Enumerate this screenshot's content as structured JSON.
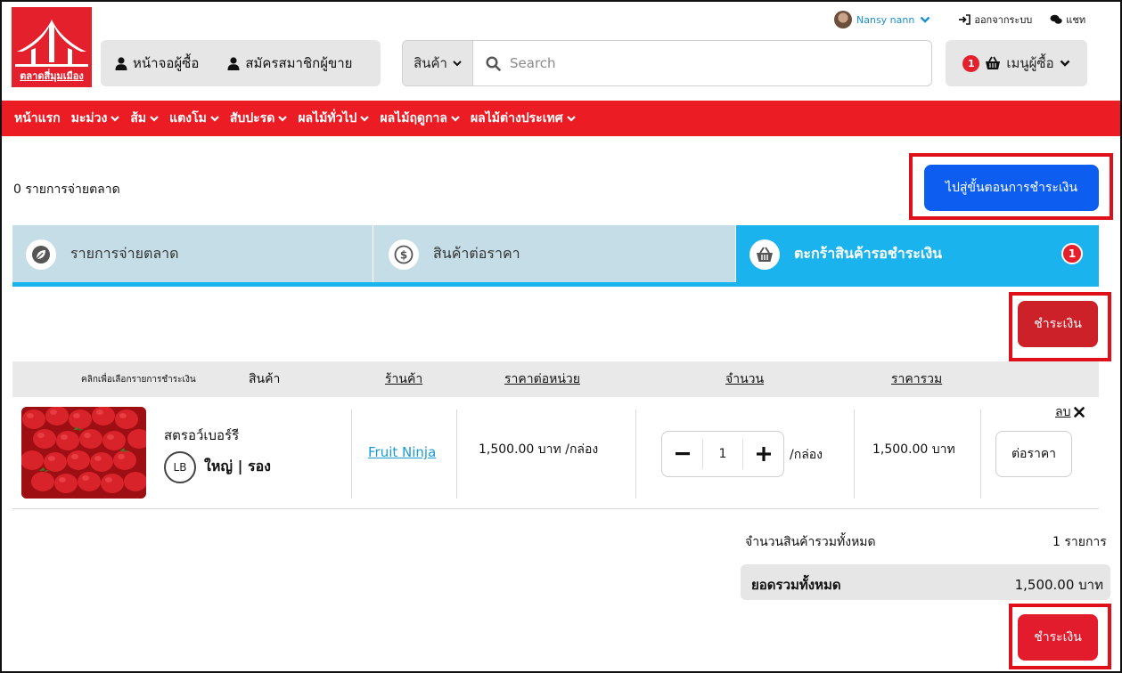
{
  "header": {
    "logo_text": "ตลาดสี่มุมเมือง",
    "buyer_page": "หน้าจอผู้ซื้อ",
    "register_seller": "สมัครสมาชิกผู้ขาย",
    "search_category": "สินค้า",
    "search_placeholder": "Search",
    "cart_menu_label": "เมนูผู้ซื้อ",
    "cart_badge": "1",
    "user_name": "Nansy nann",
    "logout": "ออกจากระบบ",
    "chat": "แชท"
  },
  "categories": [
    {
      "label": "หน้าแรก",
      "dropdown": false
    },
    {
      "label": "มะม่วง",
      "dropdown": true
    },
    {
      "label": "ส้ม",
      "dropdown": true
    },
    {
      "label": "แตงโม",
      "dropdown": true
    },
    {
      "label": "สับปะรด",
      "dropdown": true
    },
    {
      "label": "ผลไม้ทั่วไป",
      "dropdown": true
    },
    {
      "label": "ผลไม้ฤดูกาล",
      "dropdown": true
    },
    {
      "label": "ผลไม้ต่างประเทศ",
      "dropdown": true
    }
  ],
  "market": {
    "count_text": "0 รายการจ่ายตลาด",
    "checkout_button": "ไปสู่ขั้นตอนการชำระเงิน"
  },
  "tabs": [
    {
      "label": "รายการจ่ายตลาด",
      "icon": "leaf-icon"
    },
    {
      "label": "สินค้าต่อราคา",
      "icon": "coin-icon"
    },
    {
      "label": "ตะกร้าสินค้ารอชำระเงิน",
      "icon": "basket-icon",
      "badge": "1"
    }
  ],
  "pay_button": "ชำระเงิน",
  "table": {
    "select_hint": "คลิกเพื่อเลือกรายการชำระเงิน",
    "headers": {
      "product": "สินค้า",
      "store": "ร้านค้า",
      "unit_price": "ราคาต่อหน่วย",
      "quantity": "จำนวน",
      "total": "ราคารวม"
    },
    "rows": [
      {
        "name": "สตรอว์เบอร์รี",
        "unit_badge": "LB",
        "sizes": "ใหญ่ | รอง",
        "store": "Fruit Ninja",
        "unit_price": "1,500.00 บาท /กล่อง",
        "quantity": "1",
        "unit": "/กล่อง",
        "total": "1,500.00 บาท",
        "negotiate": "ต่อราคา",
        "delete": "ลบ"
      }
    ]
  },
  "summary": {
    "count_label": "จำนวนสินค้ารวมทั้งหมด",
    "count_value": "1 รายการ",
    "total_label": "ยอดรวมทั้งหมด",
    "total_value": "1,500.00 บาท"
  },
  "colors": {
    "brand_red": "#ec1c24",
    "primary_blue": "#0d5ef0",
    "tab_active": "#1ab3ee",
    "tab_inactive": "#c5dde6",
    "highlight_border": "#e0101b"
  }
}
